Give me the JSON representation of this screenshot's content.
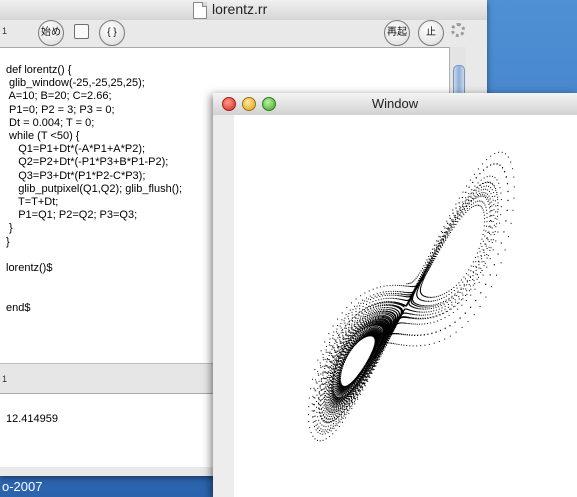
{
  "editor": {
    "title": "lorentz.rr",
    "pane_label_top": "1",
    "pane_label_bottom": "1",
    "buttons": {
      "start": "始め",
      "braces": "{ }",
      "restart": "再起",
      "stop": "止"
    },
    "code_lines": [
      "def lorentz() {",
      " glib_window(-25,-25,25,25);",
      " A=10; B=20; C=2.66;",
      " P1=0; P2 = 3; P3 = 0;",
      " Dt = 0.004; T = 0;",
      " while (T <50) {",
      "    Q1=P1+Dt*(-A*P1+A*P2);",
      "    Q2=P2+Dt*(-P1*P3+B*P1-P2);",
      "    Q3=P3+Dt*(P1*P2-C*P3);",
      "    glib_putpixel(Q1,Q2); glib_flush();",
      "    T=T+Dt;",
      "    P1=Q1; P2=Q2; P3=Q3;",
      " }",
      "}",
      "",
      "lorentz()$",
      "",
      "",
      "end$"
    ],
    "output": "12.414959"
  },
  "graphics_window": {
    "title": "Window"
  },
  "desktop": {
    "footer_text": "o-2007"
  }
}
